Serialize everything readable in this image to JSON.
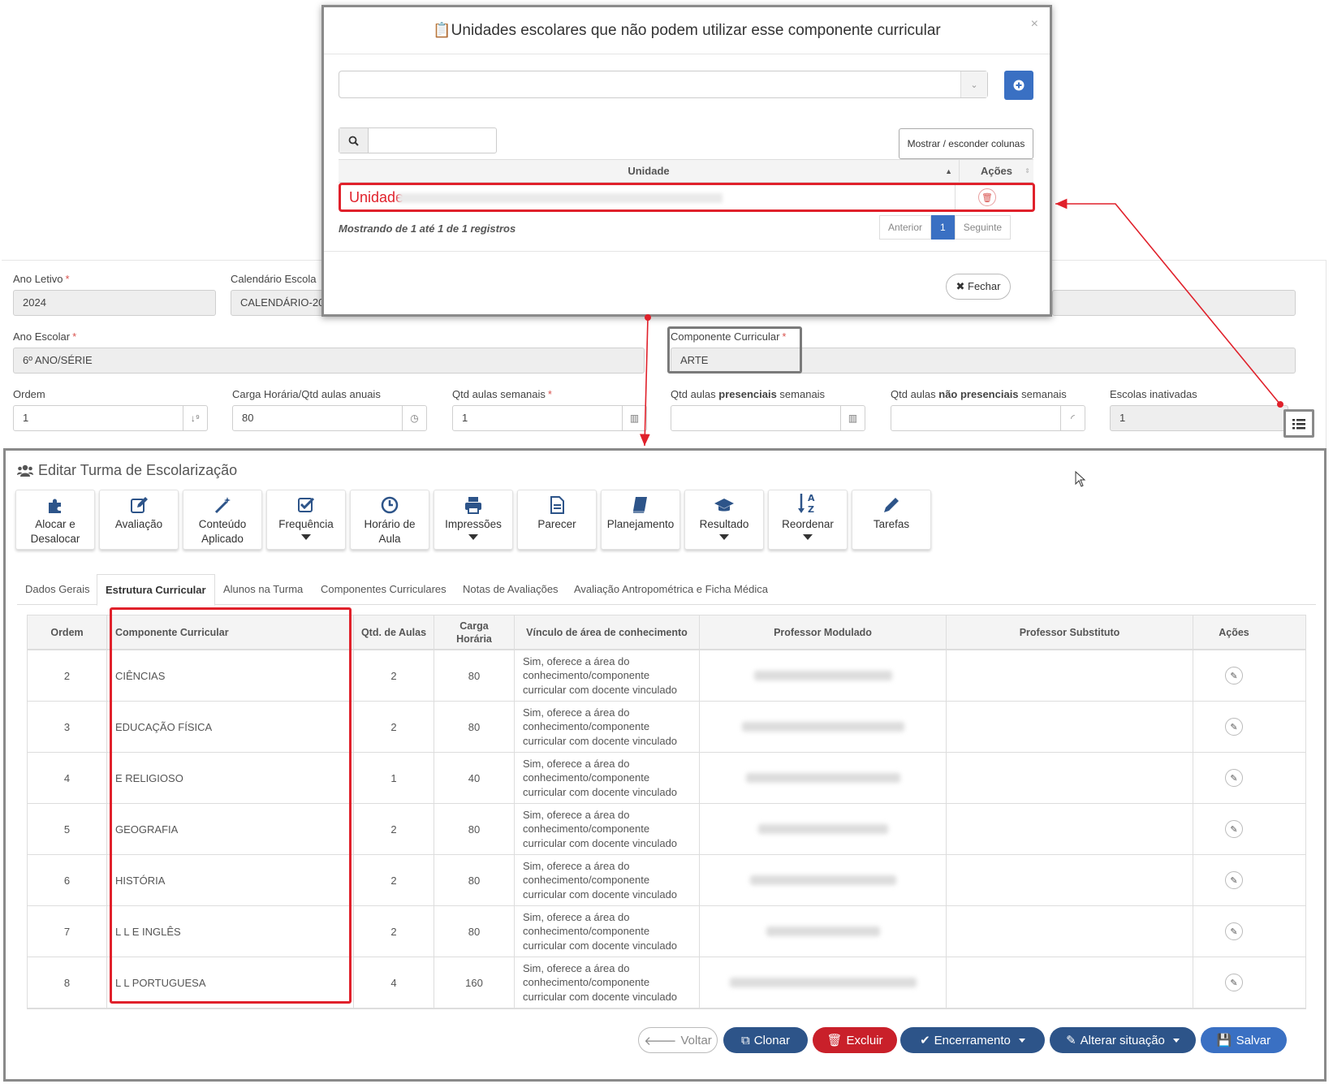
{
  "modal": {
    "title": "Unidades escolares que não podem utilizar esse componente curricular",
    "close": "×",
    "columns_button": "Mostrar / esconder colunas",
    "col_unidade": "Unidade",
    "col_acoes": "Ações",
    "row_label": "Unidade",
    "info": "Mostrando de 1 até 1 de 1 registros",
    "pager": {
      "prev": "Anterior",
      "page": "1",
      "next": "Seguinte"
    },
    "close_button": "Fechar"
  },
  "form": {
    "ano_letivo": {
      "label": "Ano Letivo",
      "req": "*",
      "value": "2024"
    },
    "calendario": {
      "label": "Calendário Escola",
      "value": "CALENDÁRIO-20"
    },
    "ano_escolar": {
      "label": "Ano Escolar",
      "req": "*",
      "value": "6º ANO/SÉRIE"
    },
    "componente": {
      "label": "Componente Curricular",
      "req": "*",
      "value": "ARTE"
    },
    "ordem": {
      "label": "Ordem",
      "value": "1"
    },
    "carga": {
      "label": "Carga Horária/Qtd aulas anuais",
      "value": "80"
    },
    "qtd_semanais": {
      "label": "Qtd aulas semanais",
      "req": "*",
      "value": "1"
    },
    "presenciais": {
      "pre": "Qtd aulas ",
      "bold": "presenciais",
      "post": " semanais",
      "value": ""
    },
    "nao_presenciais": {
      "pre": "Qtd aulas ",
      "bold": "não presenciais",
      "post": " semanais",
      "value": ""
    },
    "escolas_inativadas": {
      "label": "Escolas inativadas",
      "value": "1"
    }
  },
  "panel": {
    "title": "Editar Turma de Escolarização",
    "toolbar": [
      {
        "l1": "Alocar e",
        "l2": "Desalocar",
        "icon": "puzzle-icon"
      },
      {
        "l1": "Avaliação",
        "l2": "",
        "icon": "edit-icon"
      },
      {
        "l1": "Conteúdo",
        "l2": "Aplicado",
        "icon": "magic-wand-icon"
      },
      {
        "l1": "Frequência",
        "l2": "",
        "icon": "checkbox-icon",
        "dropdown": true
      },
      {
        "l1": "Horário de",
        "l2": "Aula",
        "icon": "clock-icon"
      },
      {
        "l1": "Impressões",
        "l2": "",
        "icon": "printer-icon",
        "dropdown": true
      },
      {
        "l1": "Parecer",
        "l2": "",
        "icon": "file-icon"
      },
      {
        "l1": "Planejamento",
        "l2": "",
        "icon": "book-icon"
      },
      {
        "l1": "Resultado",
        "l2": "",
        "icon": "graduation-cap-icon",
        "dropdown": true
      },
      {
        "l1": "Reordenar",
        "l2": "",
        "icon": "sort-alpha-icon",
        "dropdown": true
      },
      {
        "l1": "Tarefas",
        "l2": "",
        "icon": "pencil-icon"
      }
    ],
    "tabs": [
      "Dados Gerais",
      "Estrutura Curricular",
      "Alunos na Turma",
      "Componentes Curriculares",
      "Notas de Avaliações",
      "Avaliação Antropométrica e Ficha Médica"
    ],
    "active_tab": "Estrutura Curricular",
    "table": {
      "headers": {
        "ordem": "Ordem",
        "componente": "Componente Curricular",
        "qtd": "Qtd. de Aulas",
        "carga": "Carga Horária",
        "vinculo": "Vínculo de área de conhecimento",
        "prof_mod": "Professor Modulado",
        "prof_sub": "Professor Substituto",
        "acoes": "Ações"
      },
      "rows": [
        {
          "ordem": "2",
          "componente": "CIÊNCIAS",
          "qtd": "2",
          "carga": "80",
          "vinculo": "Sim, oferece a área do conhecimento/componente curricular com docente vinculado"
        },
        {
          "ordem": "3",
          "componente": "EDUCAÇÃO FÍSICA",
          "qtd": "2",
          "carga": "80",
          "vinculo": "Sim, oferece a área do conhecimento/componente curricular com docente vinculado"
        },
        {
          "ordem": "4",
          "componente": "E RELIGIOSO",
          "qtd": "1",
          "carga": "40",
          "vinculo": "Sim, oferece a área do conhecimento/componente curricular com docente vinculado"
        },
        {
          "ordem": "5",
          "componente": "GEOGRAFIA",
          "qtd": "2",
          "carga": "80",
          "vinculo": "Sim, oferece a área do conhecimento/componente curricular com docente vinculado"
        },
        {
          "ordem": "6",
          "componente": "HISTÓRIA",
          "qtd": "2",
          "carga": "80",
          "vinculo": "Sim, oferece a área do conhecimento/componente curricular com docente vinculado"
        },
        {
          "ordem": "7",
          "componente": "L L E INGLÊS",
          "qtd": "2",
          "carga": "80",
          "vinculo": "Sim, oferece a área do conhecimento/componente curricular com docente vinculado"
        },
        {
          "ordem": "8",
          "componente": "L L PORTUGUESA",
          "qtd": "4",
          "carga": "160",
          "vinculo": "Sim, oferece a área do conhecimento/componente curricular com docente vinculado"
        }
      ]
    },
    "buttons": {
      "voltar": "Voltar",
      "clonar": "Clonar",
      "excluir": "Excluir",
      "encerramento": "Encerramento",
      "alterar": "Alterar situação",
      "salvar": "Salvar"
    }
  },
  "colors": {
    "accent": "#3a70c3",
    "dark_btn": "#2d5489",
    "danger": "#c9202a",
    "highlight_red": "#e0212b",
    "highlight_grey": "#8a8a8a"
  }
}
